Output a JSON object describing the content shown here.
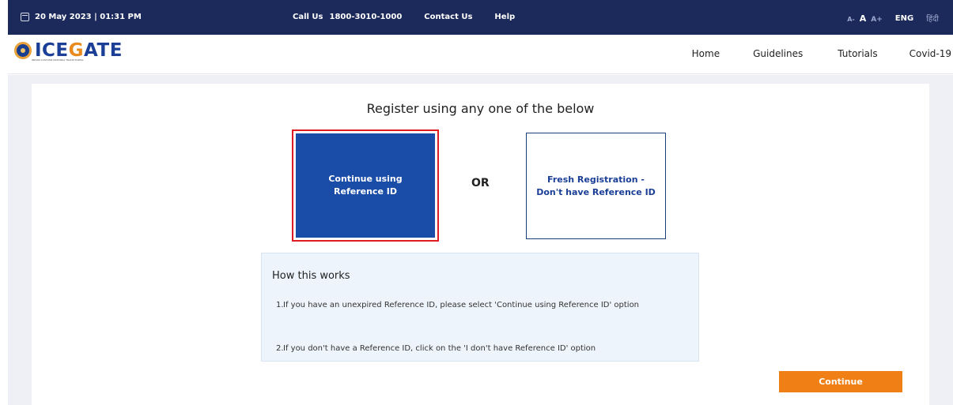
{
  "topbar": {
    "datetime": "20 May 2023 | 01:31 PM",
    "call_label": "Call Us",
    "call_number": "1800-3010-1000",
    "contact_label": "Contact Us",
    "help_label": "Help",
    "font_small": "A-",
    "font_normal": "A",
    "font_large": "A+",
    "lang_en": "ENG",
    "lang_hi": "हिंदी"
  },
  "header": {
    "logo_pre": "ICE",
    "logo_g": "G",
    "logo_post": "ATE",
    "logo_sub": "INDIAN CUSTOMS NATIONAL TRADE PORTAL",
    "nav": [
      "Home",
      "Guidelines",
      "Tutorials",
      "Covid-19"
    ]
  },
  "main": {
    "title": "Register using any one of the below",
    "option_selected": "Continue using Reference ID",
    "or_label": "OR",
    "option_other": "Fresh Registration - Don't have Reference ID",
    "how": {
      "heading": "How this works",
      "items": [
        "If you have an unexpired Reference ID, please select 'Continue using Reference ID' option",
        "If you don't have a Reference ID, click on the 'I don't have Reference ID' option"
      ],
      "numbers": [
        "1.",
        "2."
      ]
    },
    "continue_label": "Continue"
  },
  "colors": {
    "topbar_bg": "#1b2a5a",
    "selected_bg": "#1a4da8",
    "selected_border": "#e11b22",
    "button_bg": "#f07f16",
    "info_bg": "#eef4fb"
  },
  "icons": [
    "calendar-icon",
    "emblem-icon"
  ]
}
